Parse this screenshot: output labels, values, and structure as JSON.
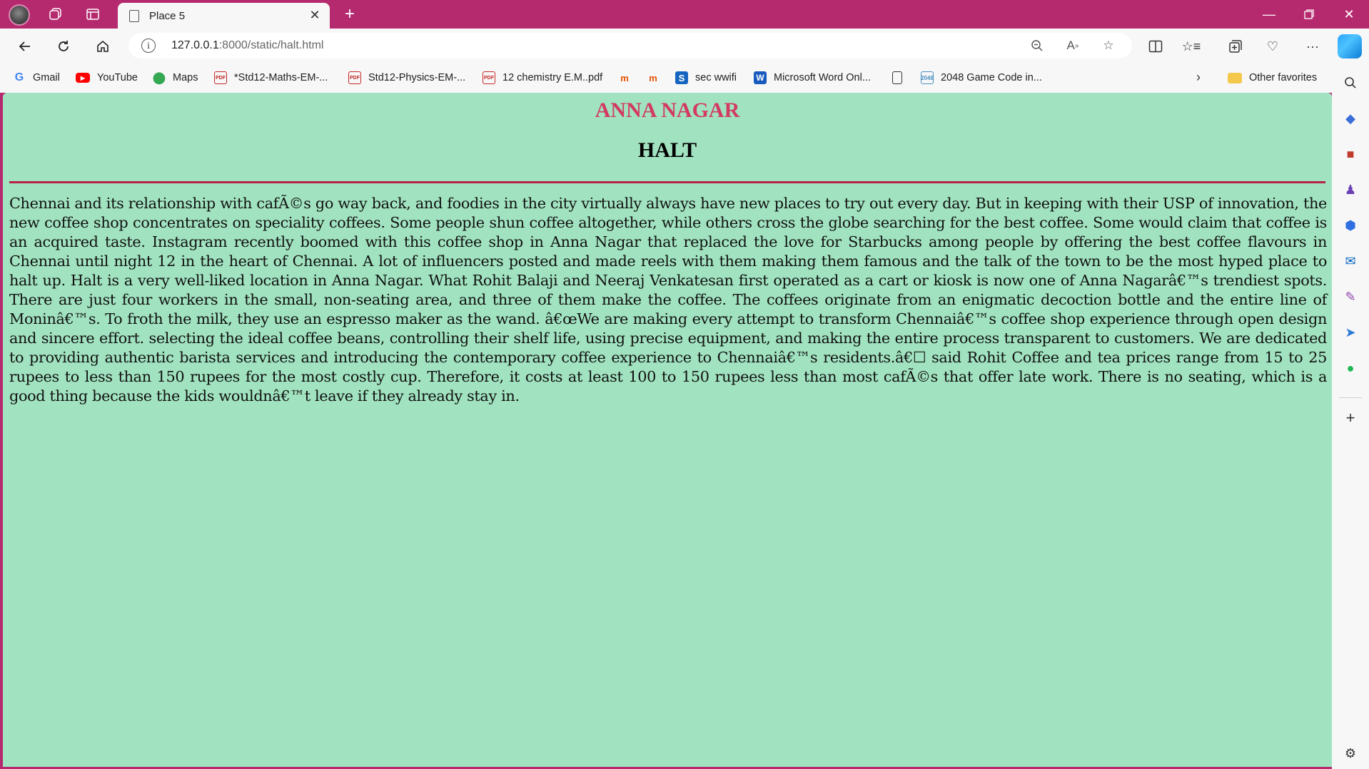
{
  "browser": {
    "tab": {
      "title": "Place 5"
    },
    "address": {
      "host": "127.0.0.1",
      "rest": ":8000/static/halt.html"
    },
    "favorites": [
      {
        "label": "Gmail",
        "icon": "gmail-icon"
      },
      {
        "label": "YouTube",
        "icon": "youtube-icon"
      },
      {
        "label": "Maps",
        "icon": "maps-icon"
      },
      {
        "label": "*Std12-Maths-EM-...",
        "icon": "pdf-icon"
      },
      {
        "label": "Std12-Physics-EM-...",
        "icon": "pdf-icon"
      },
      {
        "label": "12 chemistry E.M..pdf",
        "icon": "pdf-icon"
      },
      {
        "label": "",
        "icon": "m-icon"
      },
      {
        "label": "",
        "icon": "m-icon"
      },
      {
        "label": "sec wwifi",
        "icon": "s-icon"
      },
      {
        "label": "Microsoft Word Onl...",
        "icon": "word-icon"
      },
      {
        "label": "",
        "icon": "document-icon"
      },
      {
        "label": "2048 Game Code in...",
        "icon": "2048-icon"
      }
    ],
    "other_favorites": "Other favorites"
  },
  "page": {
    "place": "ANNA NAGAR",
    "heading": "HALT",
    "body": "Chennai and its relationship with cafÃ©s go way back, and foodies in the city virtually always have new places to try out every day. But in keeping with their USP of innovation, the new coffee shop concentrates on speciality coffees. Some people shun coffee altogether, while others cross the globe searching for the best coffee. Some would claim that coffee is an acquired taste. Instagram recently boomed with this coffee shop in Anna Nagar that replaced the love for Starbucks among people by offering the best coffee flavours in Chennai until night 12 in the heart of Chennai. A lot of influencers posted and made reels with them making them famous and the talk of the town to be the most hyped place to halt up. Halt is a very well-liked location in Anna Nagar. What Rohit Balaji and Neeraj Venkatesan first operated as a cart or kiosk is now one of Anna Nagarâ€™s trendiest spots. There are just four workers in the small, non-seating area, and three of them make the coffee. The coffees originate from an enigmatic decoction bottle and the entire line of Moninâ€™s. To froth the milk, they use an espresso maker as the wand. â€œWe are making every attempt to transform Chennaiâ€™s coffee shop experience through open design and sincere effort. selecting the ideal coffee beans, controlling their shelf life, using precise equipment, and making the entire process transparent to customers. We are dedicated to providing authentic barista services and introducing the contemporary coffee experience to Chennaiâ€™s residents.â€☐ said Rohit Coffee and tea prices range from 15 to 25 rupees to less than 150 rupees for the most costly cup. Therefore, it costs at least 100 to 150 rupees less than most cafÃ©s that offer late work. There is no seating, which is a good thing because the kids wouldnâ€™t leave if they already stay in."
  },
  "colors": {
    "frame": "#b5296f",
    "page_background": "#a1e3c0",
    "place_title": "#d23a63",
    "divider": "#b51f4a"
  }
}
